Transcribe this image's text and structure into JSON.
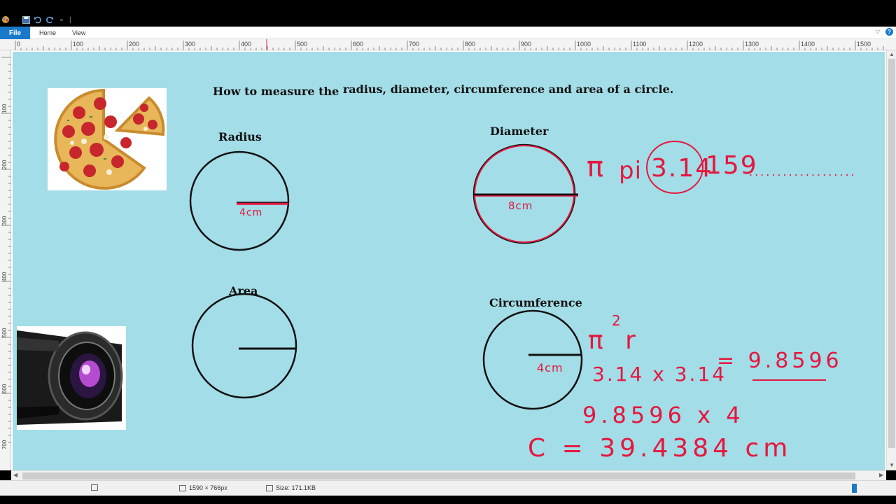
{
  "ribbon": {
    "file_tab": "File",
    "tabs": [
      "Home",
      "View"
    ]
  },
  "ruler": {
    "labels": [
      "0",
      "100",
      "200",
      "300",
      "400",
      "500",
      "600",
      "700",
      "800",
      "900",
      "1000",
      "1100",
      "1200",
      "1300",
      "1400",
      "1500"
    ],
    "vertical_labels": [
      "100",
      "200",
      "300",
      "400",
      "500",
      "600",
      "700"
    ]
  },
  "canvas": {
    "title_part1": "How to measure the",
    "title_part2": "radius, diameter, circumference and area of a circle.",
    "label_radius": "Radius",
    "label_diameter": "Diameter",
    "label_area": "Area",
    "label_circumference": "Circumference",
    "radius_measure": "4cm",
    "diameter_measure": "8cm",
    "circumference_measure": "4cm",
    "pi_symbol": "π",
    "pi_word": "pi",
    "pi_circled": "3.14",
    "pi_rest": "159",
    "pi_dots": "...................",
    "formula_pi_r2": "π r",
    "formula_exp": "2",
    "calc1_left": "3.14 x 3.14",
    "calc1_right": "= 9.8596",
    "calc2": "9.8596 x 4",
    "calc3": "C = 39.4384 cm"
  },
  "status": {
    "image_size": "1590 × 766px",
    "file_size": "Size: 171.1KB"
  },
  "colors": {
    "canvas_bg": "#a3dde7",
    "accent": "#1979ca",
    "ink_red": "#e5173f"
  }
}
